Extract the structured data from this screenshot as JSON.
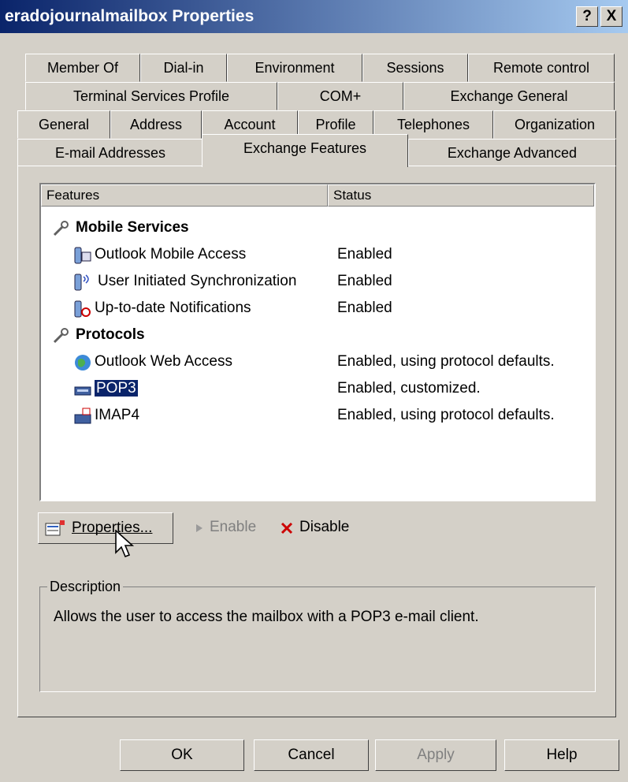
{
  "window": {
    "title": "eradojournalmailbox Properties",
    "help_glyph": "?",
    "close_glyph": "X"
  },
  "tabs": {
    "row1": [
      "Member Of",
      "Dial-in",
      "Environment",
      "Sessions",
      "Remote control"
    ],
    "row2": [
      "Terminal Services Profile",
      "COM+",
      "Exchange General"
    ],
    "row3": [
      "General",
      "Address",
      "Account",
      "Profile",
      "Telephones",
      "Organization"
    ],
    "row4": [
      "E-mail Addresses",
      "Exchange Features",
      "Exchange Advanced"
    ],
    "active": "Exchange Features"
  },
  "list": {
    "col_features": "Features",
    "col_status": "Status",
    "groups": [
      {
        "label": "Mobile Services",
        "icon": "wrench-icon",
        "items": [
          {
            "label": "Outlook Mobile Access",
            "status": "Enabled",
            "icon": "mobile-access-icon"
          },
          {
            "label": "User Initiated Synchronization",
            "status": "Enabled",
            "icon": "mobile-sync-icon"
          },
          {
            "label": "Up-to-date Notifications",
            "status": "Enabled",
            "icon": "mobile-notify-icon"
          }
        ]
      },
      {
        "label": "Protocols",
        "icon": "wrench-icon",
        "items": [
          {
            "label": "Outlook Web Access",
            "status": "Enabled, using protocol defaults.",
            "icon": "globe-icon"
          },
          {
            "label": "POP3",
            "status": "Enabled, customized.",
            "icon": "pop3-icon",
            "selected": true
          },
          {
            "label": "IMAP4",
            "status": "Enabled, using protocol defaults.",
            "icon": "imap4-icon"
          }
        ]
      }
    ]
  },
  "actions": {
    "properties": "Properties...",
    "enable": "Enable",
    "disable": "Disable"
  },
  "description": {
    "legend": "Description",
    "text": "Allows the user to access the mailbox with a POP3 e-mail client."
  },
  "footer": {
    "ok": "OK",
    "cancel": "Cancel",
    "apply": "Apply",
    "help": "Help"
  },
  "colors": {
    "title_start": "#0a246a",
    "title_end": "#a6caf0",
    "selection": "#0a246a",
    "disable_x": "#cc0000"
  }
}
